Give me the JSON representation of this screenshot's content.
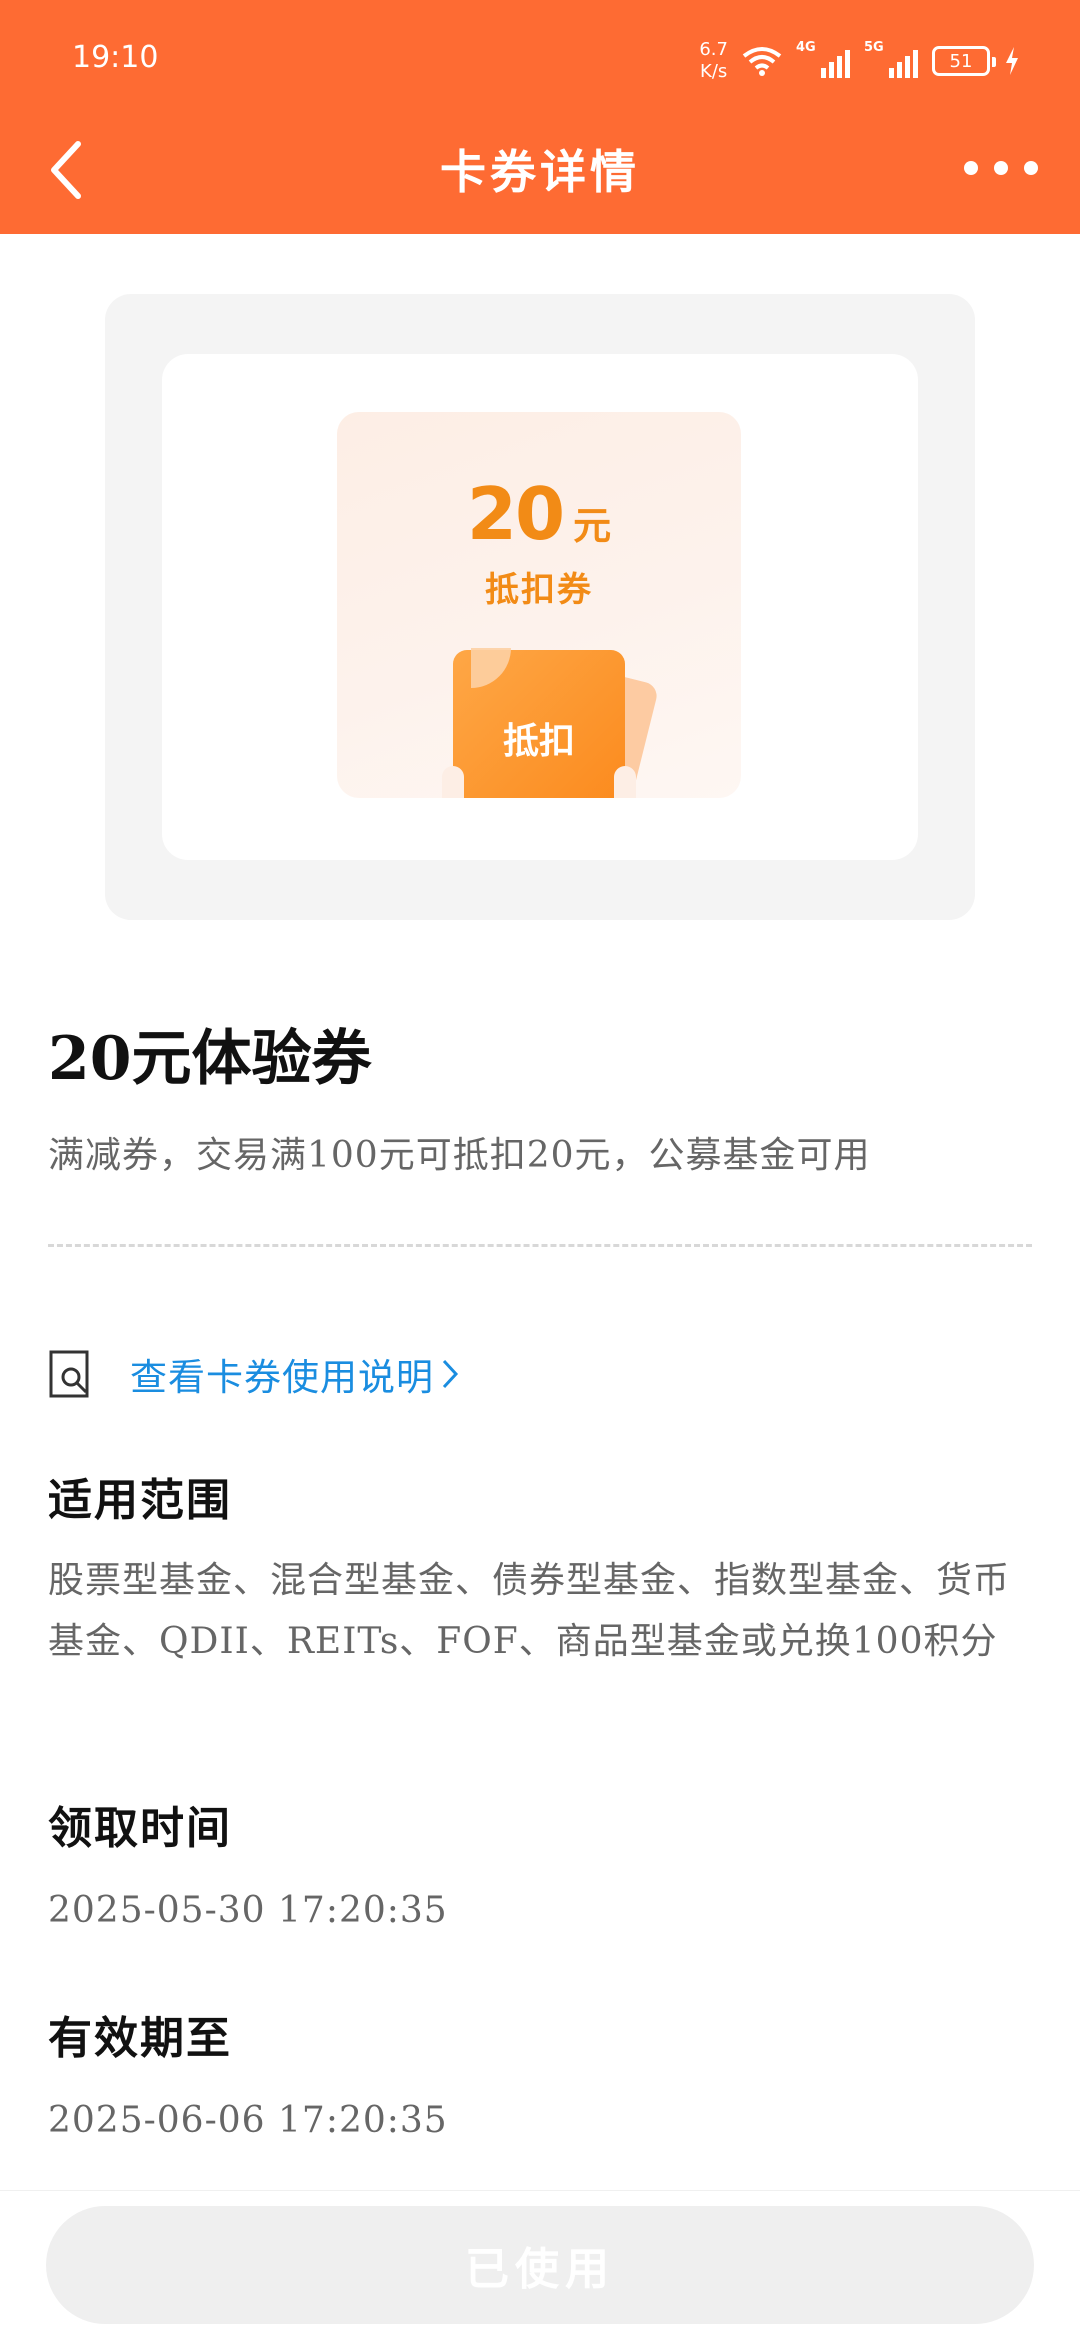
{
  "status_bar": {
    "time": "19:10",
    "net_speed_value": "6.7",
    "net_speed_unit": "K/s",
    "signal1_tag": "4G",
    "signal2_tag": "5G",
    "battery": "51"
  },
  "header": {
    "title": "卡券详情",
    "back_icon": "chevron-left-icon",
    "more_icon": "more-dots-icon"
  },
  "coupon_card": {
    "amount": "20",
    "unit": "元",
    "type": "抵扣券",
    "ticket_label": "抵扣"
  },
  "coupon": {
    "name": "20元体验券",
    "description": "满减券，交易满100元可抵扣20元，公募基金可用"
  },
  "usage_link": {
    "label": "查看卡券使用说明",
    "icon": "search-doc-icon"
  },
  "sections": {
    "scope": {
      "title": "适用范围",
      "body": "股票型基金、混合型基金、债券型基金、指数型基金、货币基金、QDII、REITs、FOF、商品型基金或兑换100积分"
    },
    "claim_time": {
      "title": "领取时间",
      "body": "2025-05-30 17:20:35"
    },
    "valid_until": {
      "title": "有效期至",
      "body": "2025-06-06 17:20:35"
    }
  },
  "action": {
    "button_label": "已使用"
  },
  "colors": {
    "brand": "#fe6b33",
    "coupon_accent": "#f28b16",
    "link": "#1a8de0"
  }
}
